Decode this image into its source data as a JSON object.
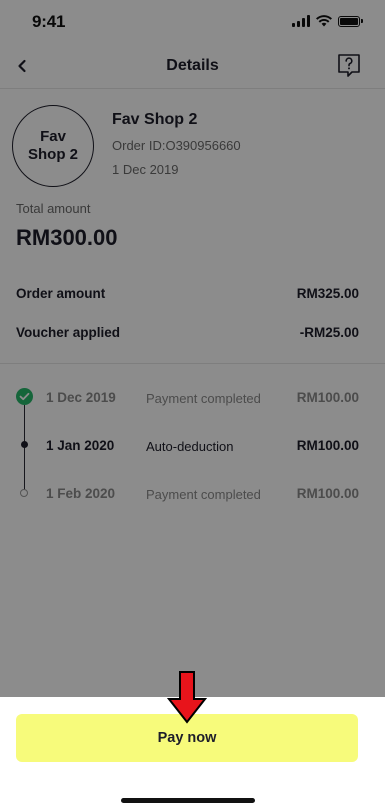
{
  "status_bar": {
    "time": "9:41"
  },
  "nav": {
    "title": "Details",
    "back_icon": "chevron-left-icon",
    "help_icon": "help-chat-icon"
  },
  "merchant": {
    "logo_text": "Fav Shop 2",
    "name": "Fav Shop 2",
    "order_id": "Order ID:O390956660",
    "date": "1 Dec 2019"
  },
  "total": {
    "label": "Total amount",
    "value": "RM300.00"
  },
  "breakdown": [
    {
      "label": "Order amount",
      "value": "RM325.00"
    },
    {
      "label": "Voucher applied",
      "value": "-RM25.00"
    }
  ],
  "installments": [
    {
      "date": "1 Dec 2019",
      "status": "Payment completed",
      "amount": "RM100.00",
      "state": "completed"
    },
    {
      "date": "1 Jan 2020",
      "status": "Auto-deduction",
      "amount": "RM100.00",
      "state": "current"
    },
    {
      "date": "1 Feb 2020",
      "status": "Payment completed",
      "amount": "RM100.00",
      "state": "upcoming"
    }
  ],
  "sheet": {
    "pay_label": "Pay now"
  },
  "colors": {
    "pay_button": "#f7fb7b",
    "completed_green": "#27b86a",
    "annotation_arrow": "#e8141b",
    "overlay": "rgba(0,0,0,0.45)"
  }
}
